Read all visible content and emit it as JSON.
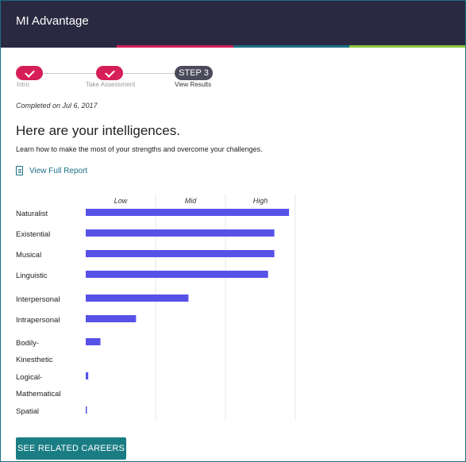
{
  "header": {
    "title": "MI Advantage",
    "stripe_colors": [
      "#2a2941",
      "#d61f58",
      "#1a6f86",
      "#8cc63f"
    ]
  },
  "stepper": {
    "steps": [
      {
        "label": "Intro",
        "state": "done"
      },
      {
        "label": "Take Assessment",
        "state": "done"
      },
      {
        "label": "View Results",
        "state": "current",
        "badge": "STEP 3"
      }
    ]
  },
  "completed_text": "Completed on Jul 6, 2017",
  "heading": "Here are your intelligences.",
  "subheading": "Learn how to make the most of your strengths and overcome your challenges.",
  "report_link": {
    "label": "View Full Report",
    "icon": "document-icon"
  },
  "chart_data": {
    "type": "bar",
    "orientation": "horizontal",
    "scale_labels": [
      "Low",
      "Mid",
      "High"
    ],
    "categories": [
      "Naturalist",
      "Existential",
      "Musical",
      "Linguistic",
      "Interpersonal",
      "Intrapersonal",
      "Bodily-Kinesthetic",
      "Logical-Mathematical",
      "Spatial"
    ],
    "category_lines": [
      [
        "Naturalist"
      ],
      [
        "Existential"
      ],
      [
        "Musical"
      ],
      [
        "Linguistic"
      ],
      [
        "Interpersonal"
      ],
      [
        "Intrapersonal"
      ],
      [
        "Bodily-",
        "Kinesthetic"
      ],
      [
        "Logical-",
        "Mathematical"
      ],
      [
        "Spatial"
      ]
    ],
    "values": [
      0.97,
      0.9,
      0.9,
      0.87,
      0.49,
      0.24,
      0.07,
      0.012,
      0.005
    ],
    "xlim": [
      0,
      1
    ],
    "bar_color": "#5851e8",
    "grid": true
  },
  "cta": {
    "label": "SEE RELATED CAREERS",
    "color": "#1a7d84"
  }
}
